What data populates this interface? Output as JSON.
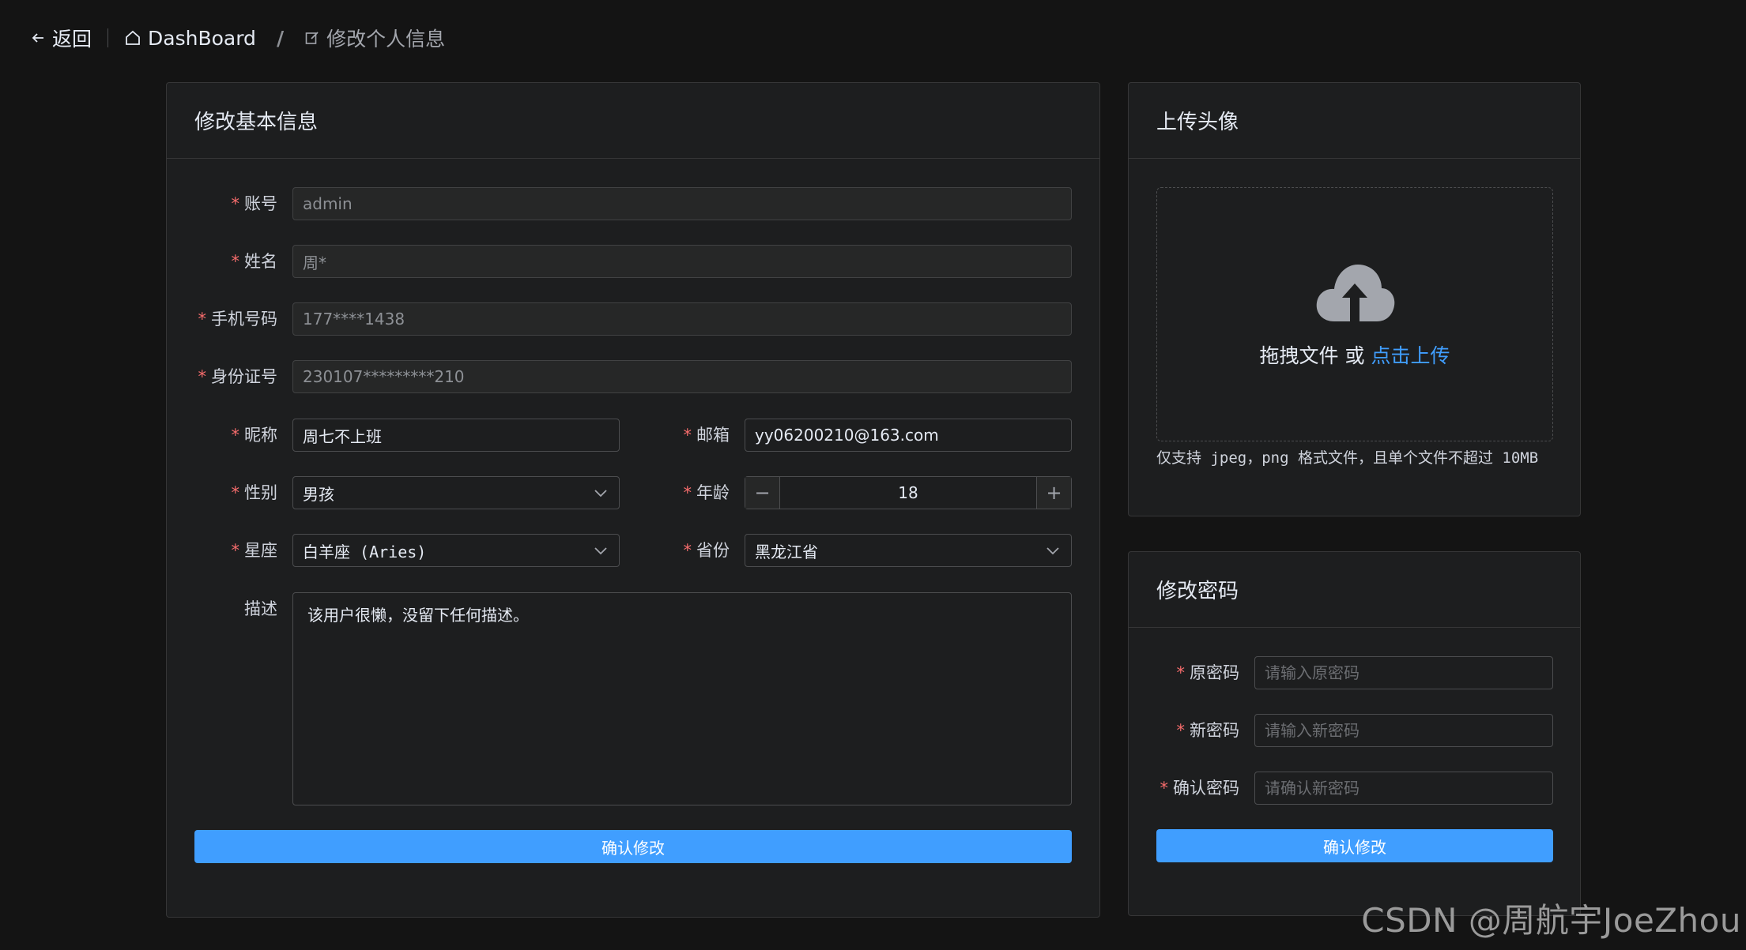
{
  "topbar": {
    "back_label": "返回",
    "crumbs": [
      "DashBoard",
      "修改个人信息"
    ],
    "separator": "/"
  },
  "profile": {
    "title": "修改基本信息",
    "fields": {
      "account": {
        "label": "账号",
        "value": "admin"
      },
      "name": {
        "label": "姓名",
        "value": "周*"
      },
      "phone": {
        "label": "手机号码",
        "value": "177****1438"
      },
      "idcard": {
        "label": "身份证号",
        "value": "230107*********210"
      },
      "nickname": {
        "label": "昵称",
        "value": "周七不上班"
      },
      "email": {
        "label": "邮箱",
        "value": "yy06200210@163.com"
      },
      "gender": {
        "label": "性别",
        "value": "男孩"
      },
      "age": {
        "label": "年龄",
        "value": "18"
      },
      "zodiac": {
        "label": "星座",
        "value": "白羊座 (Aries)"
      },
      "province": {
        "label": "省份",
        "value": "黑龙江省"
      },
      "description": {
        "label": "描述",
        "value": "该用户很懒，没留下任何描述。"
      }
    },
    "submit_label": "确认修改"
  },
  "avatar": {
    "title": "上传头像",
    "drag_text": "拖拽文件 或",
    "click_text": "点击上传",
    "tip": "仅支持 jpeg，png 格式文件，且单个文件不超过 10MB"
  },
  "password": {
    "title": "修改密码",
    "fields": {
      "old": {
        "label": "原密码",
        "placeholder": "请输入原密码"
      },
      "new": {
        "label": "新密码",
        "placeholder": "请输入新密码"
      },
      "confirm": {
        "label": "确认密码",
        "placeholder": "请确认新密码"
      }
    },
    "submit_label": "确认修改"
  },
  "watermark": "CSDN @周航宇JoeZhou",
  "colors": {
    "accent": "#409eff",
    "required": "#f56c6c",
    "background": "#141414",
    "card": "#1d1e1f"
  }
}
